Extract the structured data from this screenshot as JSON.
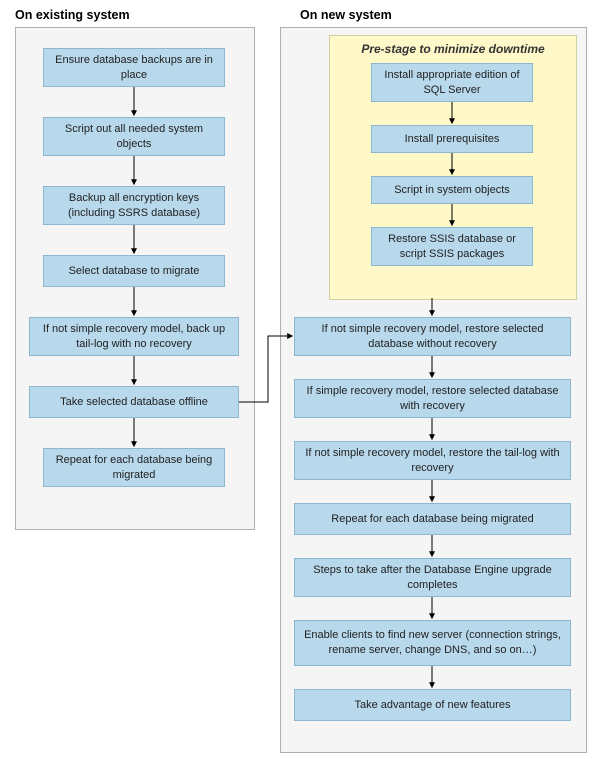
{
  "left": {
    "title": "On existing system",
    "steps": [
      "Ensure database backups are in place",
      "Script out all needed system objects",
      "Backup all encryption keys (including SSRS database)",
      "Select database to migrate",
      "If not simple recovery model, back up tail-log with no recovery",
      "Take selected database offline",
      "Repeat for each database being migrated"
    ]
  },
  "right": {
    "title": "On new system",
    "prestage_title": "Pre-stage to minimize downtime",
    "prestage_steps": [
      "Install appropriate edition of SQL Server",
      "Install prerequisites",
      "Script in system objects",
      "Restore SSIS database or script SSIS packages"
    ],
    "steps": [
      "If not simple recovery model, restore selected database without recovery",
      "If simple recovery model, restore selected database with recovery",
      "If not simple recovery model, restore the tail-log with recovery",
      "Repeat for each database being migrated",
      "Steps to take after the Database Engine upgrade completes",
      "Enable clients to find new server (connection strings, rename server, change DNS, and so on…)",
      "Take advantage of new features"
    ]
  }
}
